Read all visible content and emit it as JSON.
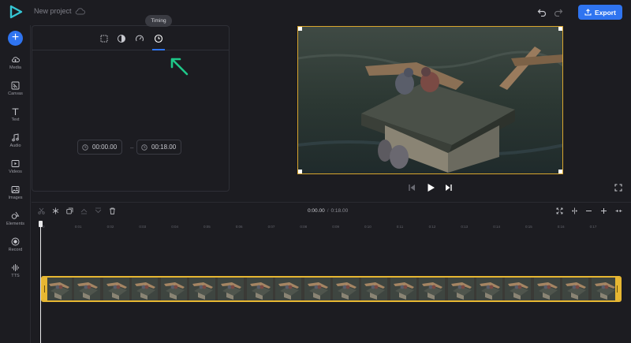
{
  "header": {
    "project_name": "New project",
    "export_label": "Export"
  },
  "sidebar": {
    "items": [
      {
        "label": "Media",
        "icon": "cloud-upload-icon"
      },
      {
        "label": "Canvas",
        "icon": "canvas-icon"
      },
      {
        "label": "Text",
        "icon": "text-icon"
      },
      {
        "label": "Audio",
        "icon": "music-note-icon"
      },
      {
        "label": "Videos",
        "icon": "video-icon"
      },
      {
        "label": "Images",
        "icon": "image-icon"
      },
      {
        "label": "Elements",
        "icon": "shapes-icon"
      },
      {
        "label": "Record",
        "icon": "record-icon"
      },
      {
        "label": "TTS",
        "icon": "waveform-icon"
      }
    ]
  },
  "panel": {
    "tabs": [
      {
        "name": "crop",
        "icon": "crop-icon"
      },
      {
        "name": "adjust",
        "icon": "contrast-icon"
      },
      {
        "name": "speed",
        "icon": "speedometer-icon"
      },
      {
        "name": "timing",
        "icon": "clock-icon"
      }
    ],
    "active_tab": "timing",
    "tooltip": "Timing",
    "start_time": "00:00.00",
    "end_time": "00:18.00",
    "dash": "–"
  },
  "timeline": {
    "current_time": "0:00.00",
    "separator": "/",
    "duration": "0:18.00",
    "ruler": [
      "0",
      "0:01",
      "0:02",
      "0:03",
      "0:04",
      "0:05",
      "0:06",
      "0:07",
      "0:08",
      "0:09",
      "0:10",
      "0:11",
      "0:12",
      "0:13",
      "0:14",
      "0:15",
      "0:16",
      "0:17"
    ],
    "clip_thumbnail_count": 20
  },
  "colors": {
    "accent": "#2f74f0",
    "clip_border": "#e7b732",
    "arrow": "#1fc889",
    "background": "#1c1c21"
  }
}
